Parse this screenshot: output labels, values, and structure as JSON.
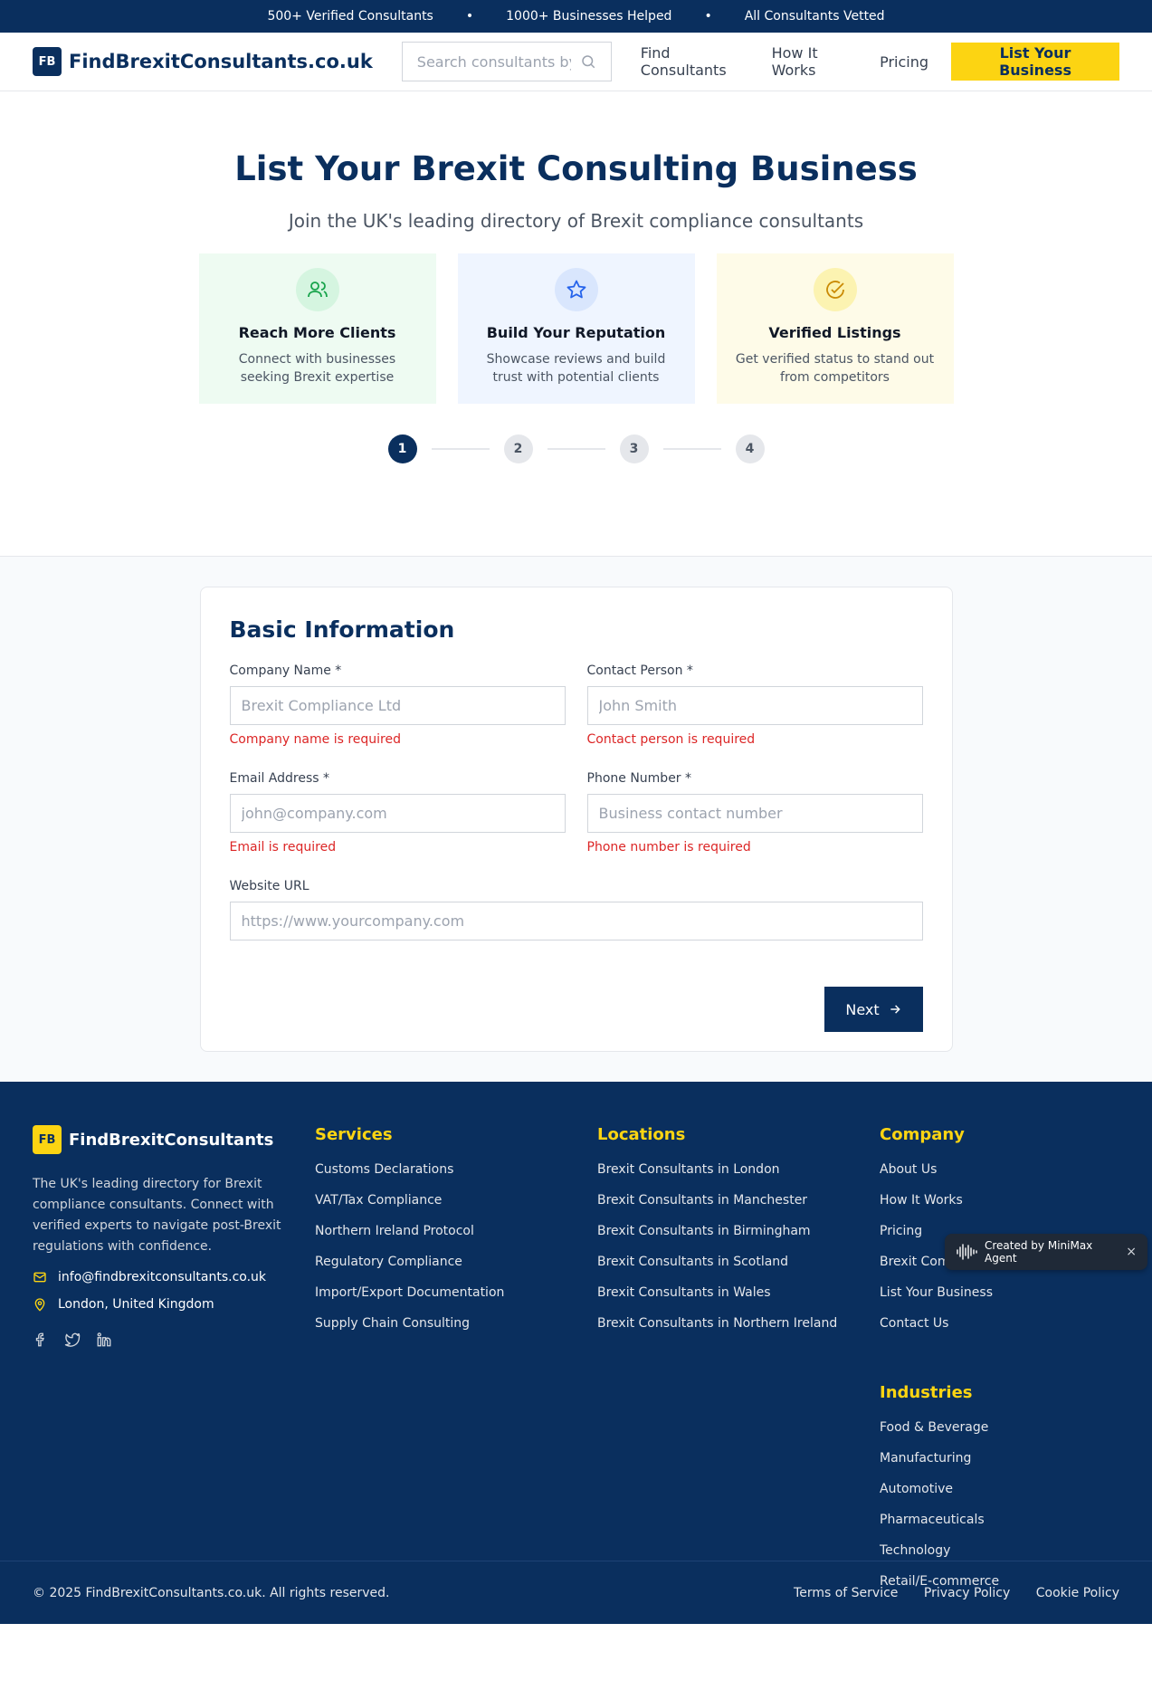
{
  "topbar": {
    "items": [
      "500+ Verified Consultants",
      "1000+ Businesses Helped",
      "All Consultants Vetted"
    ],
    "separator": "•"
  },
  "header": {
    "logo_badge": "FB",
    "logo_text": "FindBrexitConsultants.co.uk",
    "search_placeholder": "Search consultants by name or service",
    "nav": [
      "Find Consultants",
      "How It Works",
      "Pricing"
    ],
    "cta": "List Your Business"
  },
  "hero": {
    "title": "List Your Brexit Consulting Business",
    "subtitle": "Join the UK's leading directory of Brexit compliance consultants",
    "features": [
      {
        "icon": "users-icon",
        "title": "Reach More Clients",
        "text": "Connect with businesses seeking Brexit expertise"
      },
      {
        "icon": "star-icon",
        "title": "Build Your Reputation",
        "text": "Showcase reviews and build trust with potential clients"
      },
      {
        "icon": "check-circle-icon",
        "title": "Verified Listings",
        "text": "Get verified status to stand out from competitors"
      }
    ],
    "steps": [
      "1",
      "2",
      "3",
      "4"
    ],
    "active_step": "1"
  },
  "form": {
    "title": "Basic Information",
    "fields": {
      "company": {
        "label": "Company Name *",
        "placeholder": "Brexit Compliance Ltd",
        "error": "Company name is required"
      },
      "contact": {
        "label": "Contact Person *",
        "placeholder": "John Smith",
        "error": "Contact person is required"
      },
      "email": {
        "label": "Email Address *",
        "placeholder": "john@company.com",
        "error": "Email is required"
      },
      "phone": {
        "label": "Phone Number *",
        "placeholder": "Business contact number",
        "error": "Phone number is required"
      },
      "website": {
        "label": "Website URL",
        "placeholder": "https://www.yourcompany.com"
      }
    },
    "next_label": "Next"
  },
  "footer": {
    "brand_badge": "FB",
    "brand_name": "FindBrexitConsultants",
    "description": "The UK's leading directory for Brexit compliance consultants. Connect with verified experts to navigate post-Brexit regulations with confidence.",
    "email": "info@findbrexitconsultants.co.uk",
    "location": "London, United Kingdom",
    "services": {
      "title": "Services",
      "items": [
        "Customs Declarations",
        "VAT/Tax Compliance",
        "Northern Ireland Protocol",
        "Regulatory Compliance",
        "Import/Export Documentation",
        "Supply Chain Consulting"
      ]
    },
    "locations": {
      "title": "Locations",
      "items": [
        "Brexit Consultants in London",
        "Brexit Consultants in Manchester",
        "Brexit Consultants in Birmingham",
        "Brexit Consultants in Scotland",
        "Brexit Consultants in Wales",
        "Brexit Consultants in Northern Ireland"
      ]
    },
    "company": {
      "title": "Company",
      "items": [
        "About Us",
        "How It Works",
        "Pricing",
        "Brexit Compliance Guide",
        "List Your Business",
        "Contact Us"
      ]
    },
    "industries": {
      "title": "Industries",
      "items": [
        "Food & Beverage",
        "Manufacturing",
        "Automotive",
        "Pharmaceuticals",
        "Technology",
        "Retail/E-commerce"
      ]
    },
    "copyright": "© 2025 FindBrexitConsultants.co.uk. All rights reserved.",
    "legal": [
      "Terms of Service",
      "Privacy Policy",
      "Cookie Policy"
    ]
  },
  "agent_badge": {
    "label": "Created by MiniMax Agent",
    "close": "×"
  },
  "colors": {
    "navy": "#0a2f5e",
    "yellow": "#fcd412",
    "error": "#dc2626"
  }
}
